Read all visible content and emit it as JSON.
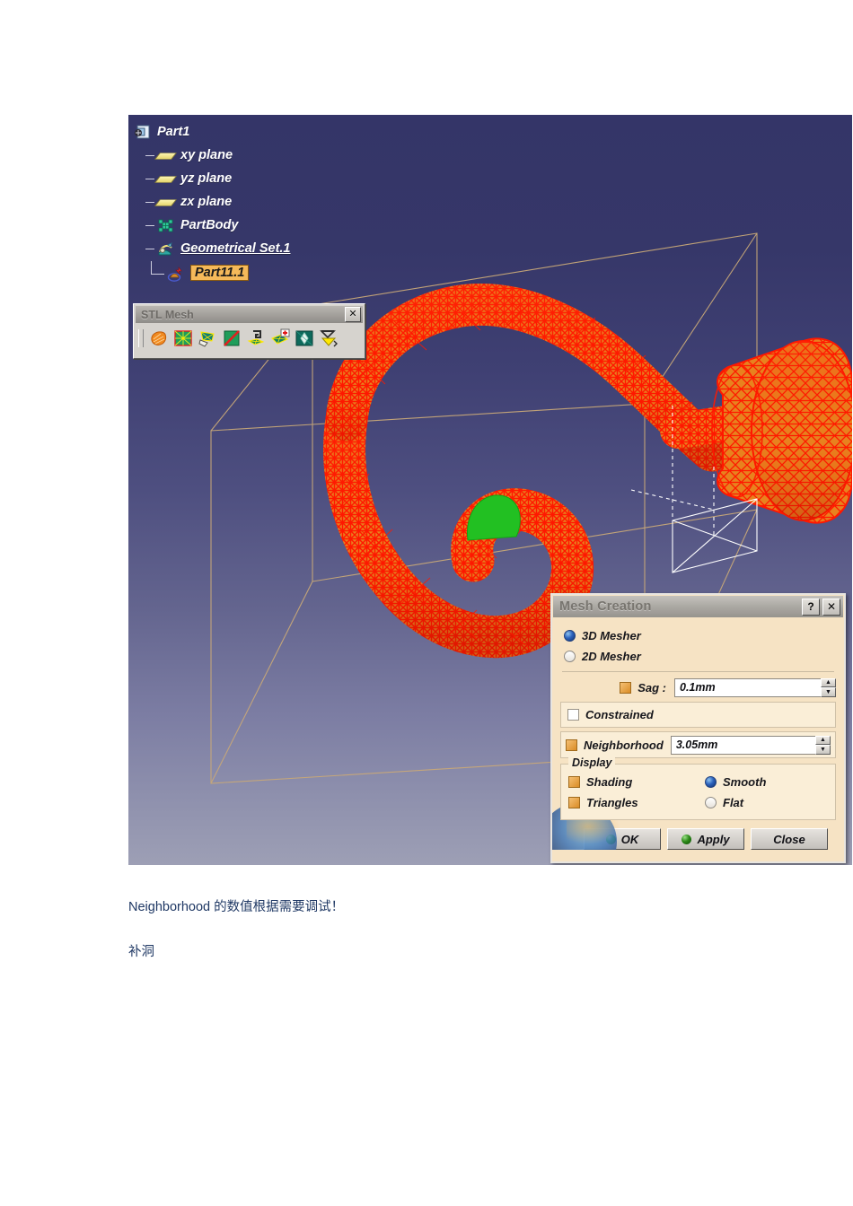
{
  "viewport": {
    "background_top": "#343568",
    "background_bottom": "#9d9fb5",
    "mesh_edge_color": "#ff1800",
    "mesh_fill_color": "#e8821e",
    "bounding_box_color": "#c8a878",
    "highlight_color": "#22c022",
    "axis_color": "#ffffff"
  },
  "tree": {
    "items": [
      {
        "label": "Part1",
        "icon": "part-icon",
        "indent": 0,
        "underline": false,
        "selected": false
      },
      {
        "label": "xy plane",
        "icon": "plane-icon",
        "indent": 1,
        "underline": false,
        "selected": false
      },
      {
        "label": "yz plane",
        "icon": "plane-icon",
        "indent": 1,
        "underline": false,
        "selected": false
      },
      {
        "label": "zx plane",
        "icon": "plane-icon",
        "indent": 1,
        "underline": false,
        "selected": false
      },
      {
        "label": "PartBody",
        "icon": "partbody-icon",
        "indent": 1,
        "underline": false,
        "selected": false
      },
      {
        "label": "Geometrical Set.1",
        "icon": "geometrical-set-icon",
        "indent": 1,
        "underline": true,
        "selected": false
      },
      {
        "label": "Part11.1",
        "icon": "mesh-feature-icon",
        "indent": 2,
        "underline": false,
        "selected": true
      }
    ]
  },
  "stl_toolbar": {
    "title": "STL Mesh",
    "close_label": "✕",
    "buttons": [
      {
        "name": "import-icon"
      },
      {
        "name": "mesh-creation-icon"
      },
      {
        "name": "fill-holes-icon"
      },
      {
        "name": "remove-triangles-icon"
      },
      {
        "name": "flip-edges-icon"
      },
      {
        "name": "add-triangle-icon"
      },
      {
        "name": "smooth-mesh-icon"
      },
      {
        "name": "decimate-icon"
      }
    ]
  },
  "mesh_dialog": {
    "title": "Mesh Creation",
    "help_label": "?",
    "close_label": "✕",
    "mesher_options": [
      {
        "label": "3D Mesher",
        "selected": true
      },
      {
        "label": "2D Mesher",
        "selected": false
      }
    ],
    "sag": {
      "label": "Sag :",
      "checked": true,
      "value": "0.1mm"
    },
    "constrained": {
      "label": "Constrained",
      "checked": false
    },
    "neighborhood": {
      "label": "Neighborhood",
      "checked": true,
      "value": "3.05mm"
    },
    "display": {
      "legend": "Display",
      "shading": {
        "label": "Shading",
        "checked": true
      },
      "triangles": {
        "label": "Triangles",
        "checked": true
      },
      "smooth": {
        "label": "Smooth",
        "selected": true
      },
      "flat": {
        "label": "Flat",
        "selected": false
      }
    },
    "buttons": {
      "ok": "OK",
      "apply": "Apply",
      "close": "Close"
    },
    "spinner_up": "▲",
    "spinner_down": "▼"
  },
  "captions": {
    "line1": "Neighborhood 的数值根据需要调试！",
    "line2": "补洞",
    "color": "#1f3864"
  }
}
